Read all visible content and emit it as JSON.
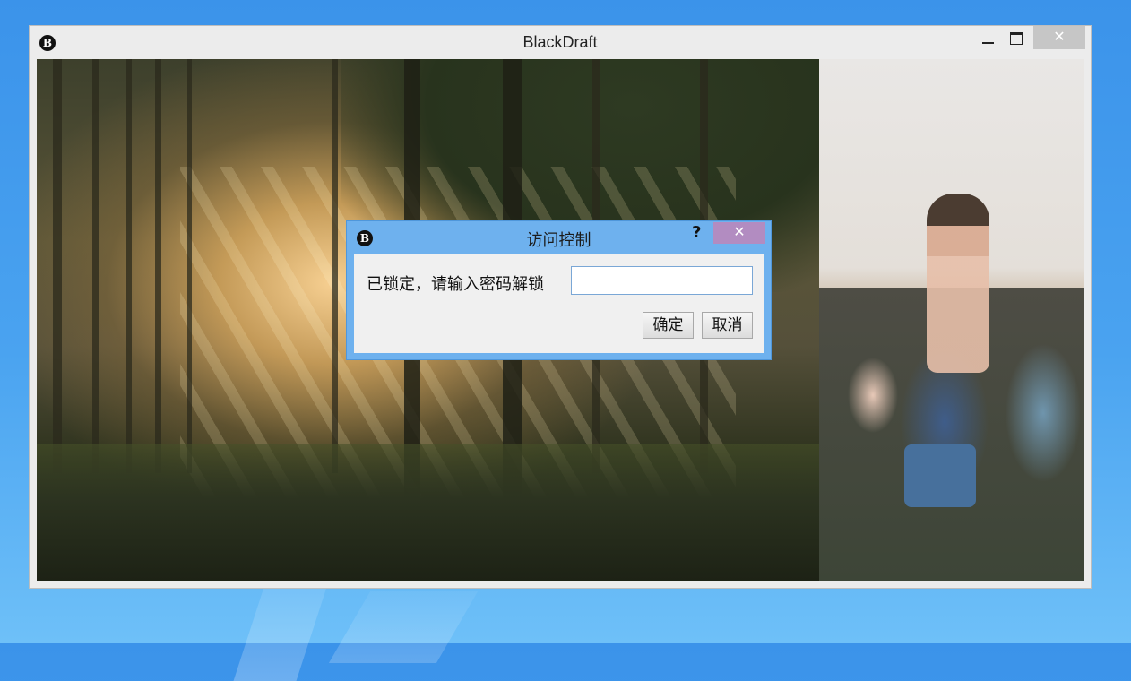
{
  "window": {
    "title": "BlackDraft",
    "icon": "B",
    "controls": {
      "minimize": "minimize-icon",
      "maximize": "maximize-icon",
      "close": "✕"
    }
  },
  "content": {
    "left_image": "forest-sunrays-image",
    "right_image": "festival-crowd-image"
  },
  "dialog": {
    "title": "访问控制",
    "icon": "B",
    "help": "?",
    "close": "✕",
    "prompt": "已锁定，请输入密码解锁",
    "password_value": "",
    "ok_label": "确定",
    "cancel_label": "取消"
  },
  "colors": {
    "dialog_frame": "#6eb1ee",
    "dialog_close": "#b28cc1",
    "window_close": "#c6c6c6",
    "desktop": "#3b93ea"
  }
}
